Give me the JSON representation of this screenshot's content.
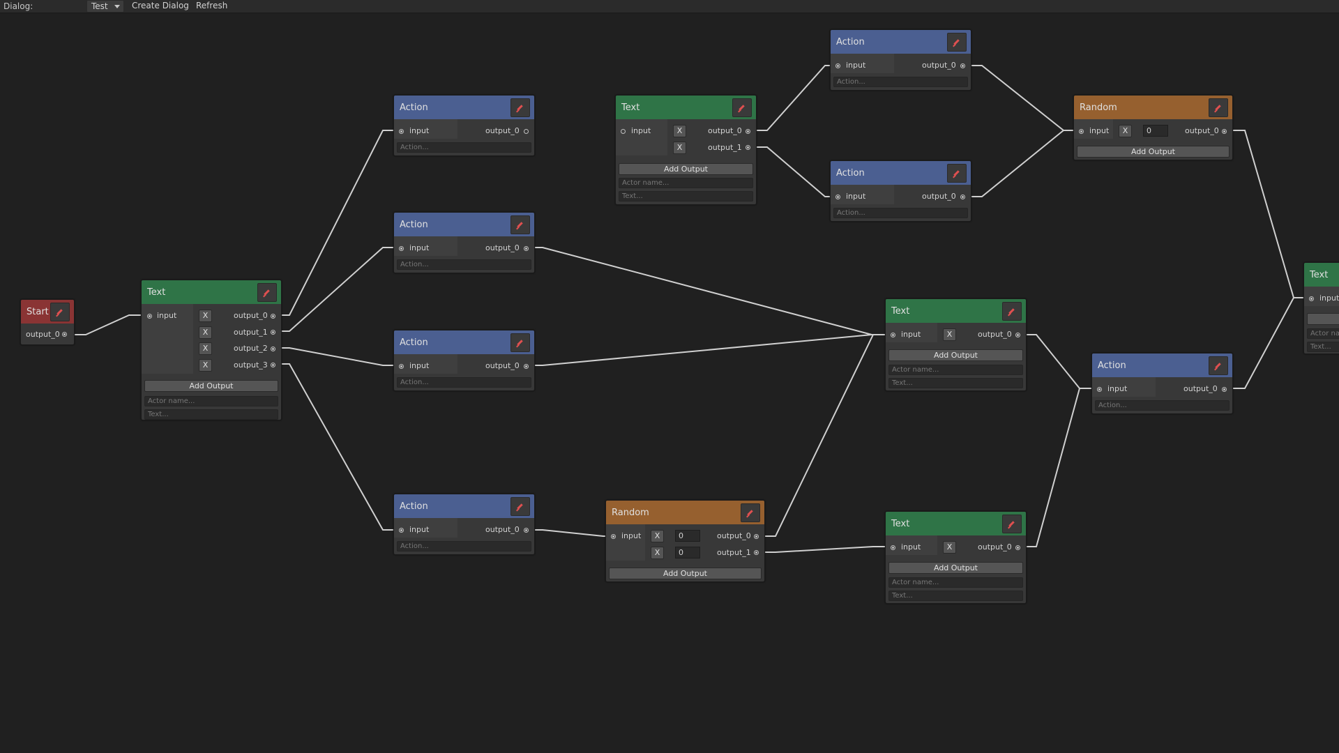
{
  "toolbar": {
    "dialog_label": "Dialog:",
    "dialog_select_value": "Test",
    "create_label": "Create Dialog",
    "refresh_label": "Refresh"
  },
  "common": {
    "input_label": "input",
    "add_output_label": "Add Output",
    "actor_placeholder": "Actor name...",
    "text_placeholder": "Text...",
    "action_placeholder": "Action...",
    "remove_label": "X",
    "actor_partial": "Actor na"
  },
  "nodes": {
    "start": {
      "title": "Start",
      "outputs": [
        "output_0"
      ]
    },
    "text1": {
      "title": "Text",
      "outputs": [
        "output_0",
        "output_1",
        "output_2",
        "output_3"
      ]
    },
    "action1": {
      "title": "Action",
      "outputs": [
        "output_0"
      ]
    },
    "action2": {
      "title": "Action",
      "outputs": [
        "output_0"
      ]
    },
    "action3": {
      "title": "Action",
      "outputs": [
        "output_0"
      ]
    },
    "action4": {
      "title": "Action",
      "outputs": [
        "output_0"
      ]
    },
    "text2": {
      "title": "Text",
      "outputs": [
        "output_0",
        "output_1"
      ]
    },
    "random1": {
      "title": "Random",
      "outputs": [
        "output_0",
        "output_1"
      ],
      "weights": [
        "0",
        "0"
      ]
    },
    "action5": {
      "title": "Action",
      "outputs": [
        "output_0"
      ]
    },
    "action6": {
      "title": "Action",
      "outputs": [
        "output_0"
      ]
    },
    "text3": {
      "title": "Text",
      "outputs": [
        "output_0"
      ]
    },
    "text4": {
      "title": "Text",
      "outputs": [
        "output_0"
      ]
    },
    "random2": {
      "title": "Random",
      "outputs": [
        "output_0"
      ],
      "weights": [
        "0"
      ]
    },
    "action7": {
      "title": "Action",
      "outputs": [
        "output_0"
      ]
    },
    "text5": {
      "title": "Text"
    }
  },
  "colors": {
    "action_header": "#4b5f91",
    "text_header": "#2f7447",
    "random_header": "#96602f",
    "start_header": "#8a3434",
    "background": "#202020",
    "wire": "#d0d0d0"
  }
}
